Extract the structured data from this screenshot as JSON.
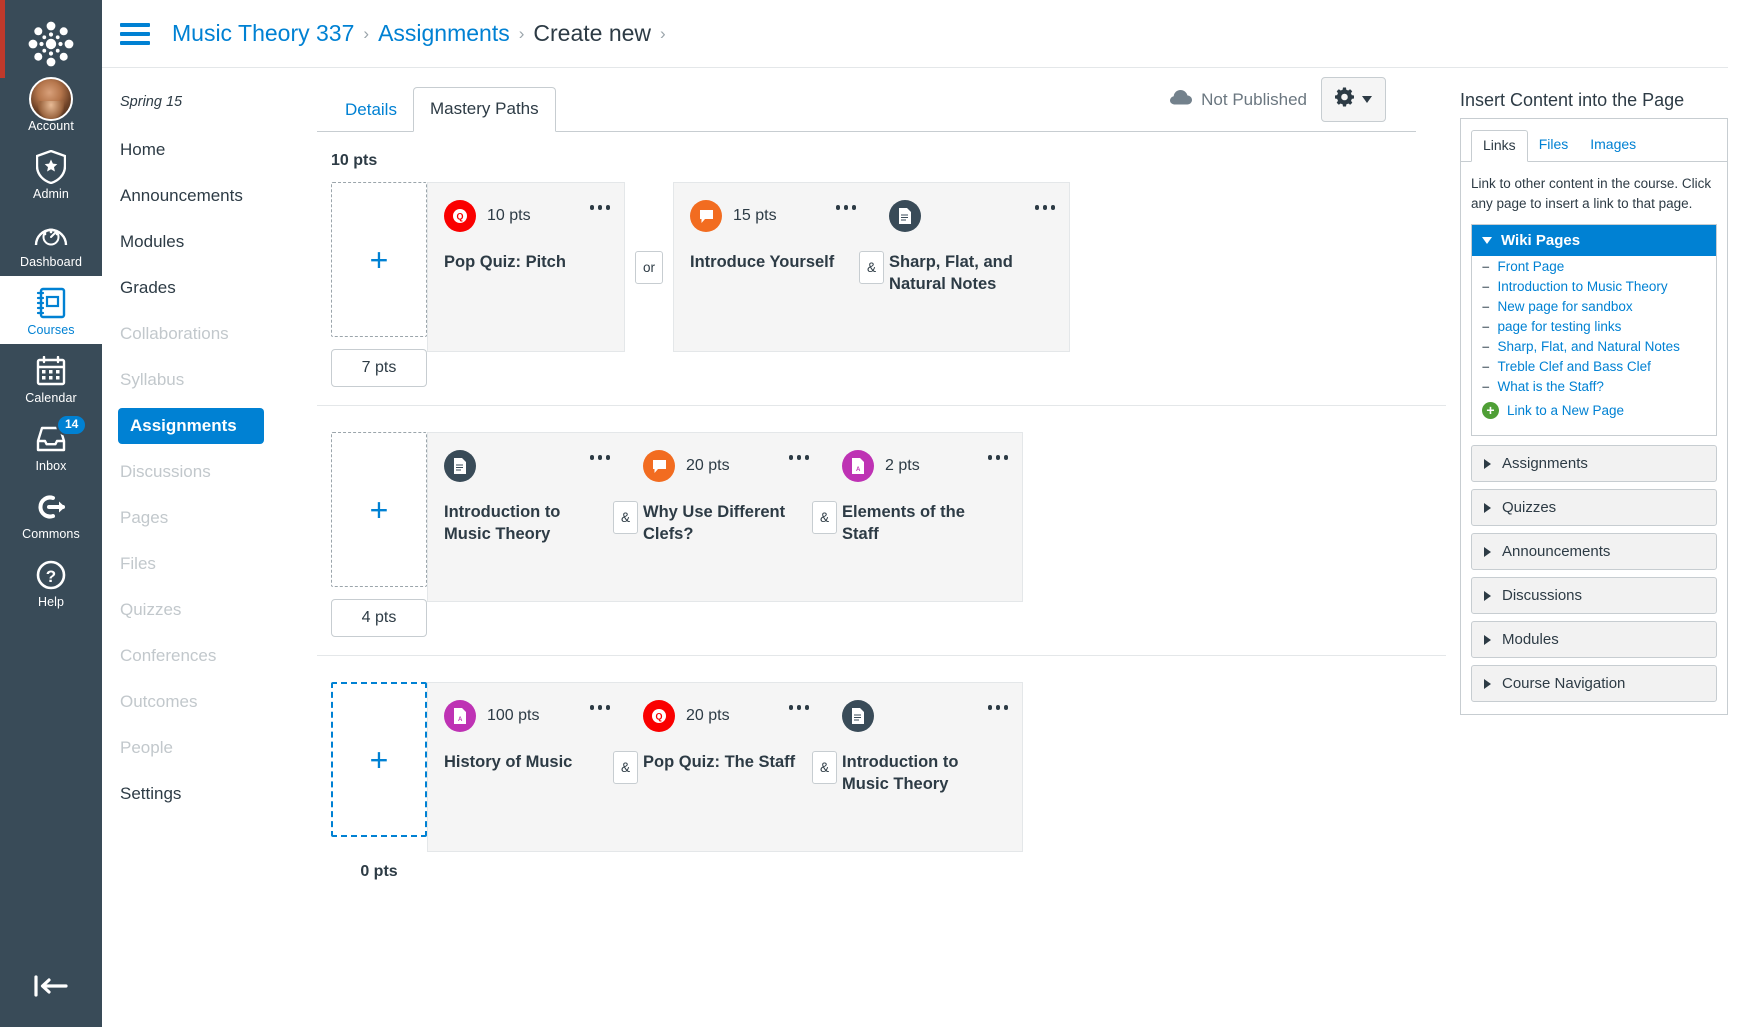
{
  "global_nav": {
    "logo": "canvas-logo",
    "items": [
      {
        "label": "Account",
        "icon": "avatar-icon",
        "active": false
      },
      {
        "label": "Admin",
        "icon": "shield-star-icon",
        "active": false
      },
      {
        "label": "Dashboard",
        "icon": "speedometer-icon",
        "active": false
      },
      {
        "label": "Courses",
        "icon": "book-icon",
        "active": true
      },
      {
        "label": "Calendar",
        "icon": "calendar-icon",
        "active": false
      },
      {
        "label": "Inbox",
        "icon": "inbox-icon",
        "active": false,
        "badge": "14"
      },
      {
        "label": "Commons",
        "icon": "commons-arrow-icon",
        "active": false
      },
      {
        "label": "Help",
        "icon": "question-circle-icon",
        "active": false
      }
    ],
    "collapse_icon": "collapse-left-icon"
  },
  "breadcrumb": {
    "menu_icon": "hamburger-menu-icon",
    "items": [
      {
        "label": "Music Theory 337",
        "current": false
      },
      {
        "label": "Assignments",
        "current": false
      },
      {
        "label": "Create new",
        "current": true
      }
    ],
    "separator": "›"
  },
  "course_nav": {
    "term": "Spring 15",
    "items": [
      {
        "label": "Home",
        "state": "normal"
      },
      {
        "label": "Announcements",
        "state": "normal"
      },
      {
        "label": "Modules",
        "state": "normal"
      },
      {
        "label": "Grades",
        "state": "normal"
      },
      {
        "label": "Collaborations",
        "state": "dim"
      },
      {
        "label": "Syllabus",
        "state": "dim"
      },
      {
        "label": "Assignments",
        "state": "active"
      },
      {
        "label": "Discussions",
        "state": "dim"
      },
      {
        "label": "Pages",
        "state": "dim"
      },
      {
        "label": "Files",
        "state": "dim"
      },
      {
        "label": "Quizzes",
        "state": "dim"
      },
      {
        "label": "Conferences",
        "state": "dim"
      },
      {
        "label": "Outcomes",
        "state": "dim"
      },
      {
        "label": "People",
        "state": "dim"
      },
      {
        "label": "Settings",
        "state": "normal"
      }
    ]
  },
  "tabs": [
    {
      "label": "Details",
      "active": false
    },
    {
      "label": "Mastery Paths",
      "active": true
    }
  ],
  "publish": {
    "status_label": "Not Published",
    "status_icon": "cloud-icon",
    "gear_icon": "gear-icon"
  },
  "paths": {
    "add_icon": "plus-icon",
    "rows": [
      {
        "top_label": "10 pts",
        "bottom_label": "7 pts",
        "bottom_style": "boxed",
        "dropzone_highlight": false,
        "groups": [
          {
            "cards": [
              {
                "points": "10 pts",
                "title": "Pop Quiz: Pitch",
                "icon": "quiz-icon",
                "icon_class": "ico-quiz",
                "kebab": "more-options-icon"
              }
            ]
          },
          {
            "cards": [
              {
                "points": "15 pts",
                "title": "Introduce Yourself",
                "icon": "discussion-icon",
                "icon_class": "ico-discussion",
                "kebab": "more-options-icon"
              },
              {
                "points": "",
                "title": "Sharp, Flat, and Natural Notes",
                "icon": "page-icon",
                "icon_class": "ico-page",
                "kebab": "more-options-icon"
              }
            ],
            "inner_connectors": [
              "&"
            ]
          }
        ],
        "group_connector": "or"
      },
      {
        "top_label": "",
        "bottom_label": "4 pts",
        "bottom_style": "boxed",
        "dropzone_highlight": false,
        "groups": [
          {
            "cards": [
              {
                "points": "",
                "title": "Introduction to Music Theory",
                "icon": "page-icon",
                "icon_class": "ico-page",
                "kebab": "more-options-icon"
              },
              {
                "points": "20 pts",
                "title": "Why Use Different Clefs?",
                "icon": "discussion-icon",
                "icon_class": "ico-discussion",
                "kebab": "more-options-icon"
              },
              {
                "points": "2 pts",
                "title": "Elements of the Staff",
                "icon": "assignment-icon",
                "icon_class": "ico-assignment",
                "kebab": "more-options-icon"
              }
            ],
            "inner_connectors": [
              "&",
              "&"
            ]
          }
        ],
        "group_connector": ""
      },
      {
        "top_label": "",
        "bottom_label": "0 pts",
        "bottom_style": "plain",
        "dropzone_highlight": true,
        "groups": [
          {
            "cards": [
              {
                "points": "100 pts",
                "title": "History of Music",
                "icon": "assignment-icon",
                "icon_class": "ico-assignment",
                "kebab": "more-options-icon"
              },
              {
                "points": "20 pts",
                "title": "Pop Quiz: The Staff",
                "icon": "quiz-icon",
                "icon_class": "ico-quiz",
                "kebab": "more-options-icon"
              },
              {
                "points": "",
                "title": "Introduction to Music Theory",
                "icon": "page-icon",
                "icon_class": "ico-page",
                "kebab": "more-options-icon"
              }
            ],
            "inner_connectors": [
              "&",
              "&"
            ]
          }
        ],
        "group_connector": ""
      }
    ]
  },
  "insert_panel": {
    "title": "Insert Content into the Page",
    "tabs": [
      {
        "label": "Links",
        "active": true
      },
      {
        "label": "Files",
        "active": false
      },
      {
        "label": "Images",
        "active": false
      }
    ],
    "description": "Link to other content in the course. Click any page to insert a link to that page.",
    "group_header": "Wiki Pages",
    "links": [
      "Front Page",
      "Introduction to Music Theory",
      "New page for sandbox",
      "page for testing links",
      "Sharp, Flat, and Natural Notes",
      "Treble Clef and Bass Clef",
      "What is the Staff?"
    ],
    "new_page_link": "Link to a New Page",
    "accordions": [
      "Assignments",
      "Quizzes",
      "Announcements",
      "Discussions",
      "Modules",
      "Course Navigation"
    ]
  },
  "colors": {
    "brand_blue": "#0081D3",
    "nav_dark": "#394B58",
    "quiz_red": "#FA0000",
    "discussion_orange": "#F26C20",
    "page_dark": "#394B58",
    "assignment_purple": "#BE32B4",
    "green_plus": "#4F9F36"
  }
}
